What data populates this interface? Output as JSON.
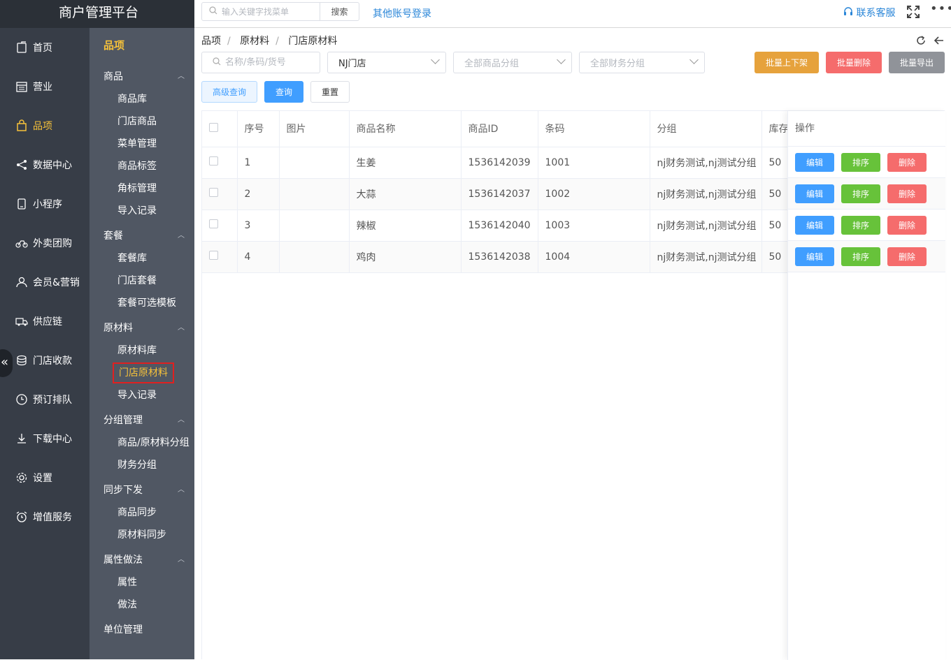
{
  "brand": "商户管理平台",
  "top": {
    "menu_search_placeholder": "输入关键字找菜单",
    "menu_search_button": "搜索",
    "other_login": "其他账号登录",
    "contact": "联系客服",
    "more": "•••"
  },
  "nav": [
    {
      "label": "首页",
      "icon": "home-icon"
    },
    {
      "label": "营业",
      "icon": "calendar-icon"
    },
    {
      "label": "品项",
      "icon": "bag-icon",
      "active": true
    },
    {
      "label": "数据中心",
      "icon": "share-icon"
    },
    {
      "label": "小程序",
      "icon": "phone-icon"
    },
    {
      "label": "外卖团购",
      "icon": "bike-icon"
    },
    {
      "label": "会员&营销",
      "icon": "user-icon"
    },
    {
      "label": "供应链",
      "icon": "truck-icon"
    },
    {
      "label": "门店收款",
      "icon": "coin-icon"
    },
    {
      "label": "预订排队",
      "icon": "clock-icon"
    },
    {
      "label": "下载中心",
      "icon": "download-icon"
    },
    {
      "label": "设置",
      "icon": "gear-icon"
    },
    {
      "label": "增值服务",
      "icon": "alarm-icon"
    }
  ],
  "collapse": "«",
  "subnav": {
    "title": "品项",
    "groups": [
      {
        "label": "商品",
        "items": [
          "商品库",
          "门店商品",
          "菜单管理",
          "商品标签",
          "角标管理",
          "导入记录"
        ]
      },
      {
        "label": "套餐",
        "items": [
          "套餐库",
          "门店套餐",
          "套餐可选模板"
        ]
      },
      {
        "label": "原材料",
        "items": [
          "原材料库",
          "门店原材料",
          "导入记录"
        ]
      },
      {
        "label": "分组管理",
        "items": [
          "商品/原材料分组",
          "财务分组"
        ]
      },
      {
        "label": "同步下发",
        "items": [
          "商品同步",
          "原材料同步"
        ]
      },
      {
        "label": "属性做法",
        "items": [
          "属性",
          "做法"
        ]
      },
      {
        "label": "单位管理",
        "items": []
      }
    ],
    "active_item": "门店原材料"
  },
  "breadcrumb": [
    "品项",
    "原材料",
    "门店原材料"
  ],
  "filters": {
    "keyword_placeholder": "名称/条码/货号",
    "store_value": "NJ门店",
    "category_placeholder": "全部商品分组",
    "finance_placeholder": "全部财务分组"
  },
  "buttons": {
    "batch_shelf": "批量上下架",
    "batch_delete": "批量删除",
    "batch_export": "批量导出",
    "advanced": "高级查询",
    "query": "查询",
    "reset": "重置"
  },
  "table": {
    "columns": [
      "序号",
      "图片",
      "商品名称",
      "商品ID",
      "条码",
      "分组",
      "库存"
    ],
    "action_header": "操作",
    "rows": [
      {
        "seq": "1",
        "name": "生姜",
        "id": "1536142039",
        "barcode": "1001",
        "group": "nj财务测试,nj测试分组",
        "stock": "50"
      },
      {
        "seq": "2",
        "name": "大蒜",
        "id": "1536142037",
        "barcode": "1002",
        "group": "nj财务测试,nj测试分组",
        "stock": "50"
      },
      {
        "seq": "3",
        "name": "辣椒",
        "id": "1536142040",
        "barcode": "1003",
        "group": "nj财务测试,nj测试分组",
        "stock": "50"
      },
      {
        "seq": "4",
        "name": "鸡肉",
        "id": "1536142038",
        "barcode": "1004",
        "group": "nj财务测试,nj测试分组",
        "stock": "50"
      }
    ],
    "actions": {
      "edit": "编辑",
      "sort": "排序",
      "delete": "删除"
    }
  },
  "colors": {
    "active": "#f5c13a",
    "primary": "#409eff",
    "success": "#67c23a",
    "danger": "#f56c6c",
    "warning": "#e6a23c",
    "info": "#909399"
  }
}
